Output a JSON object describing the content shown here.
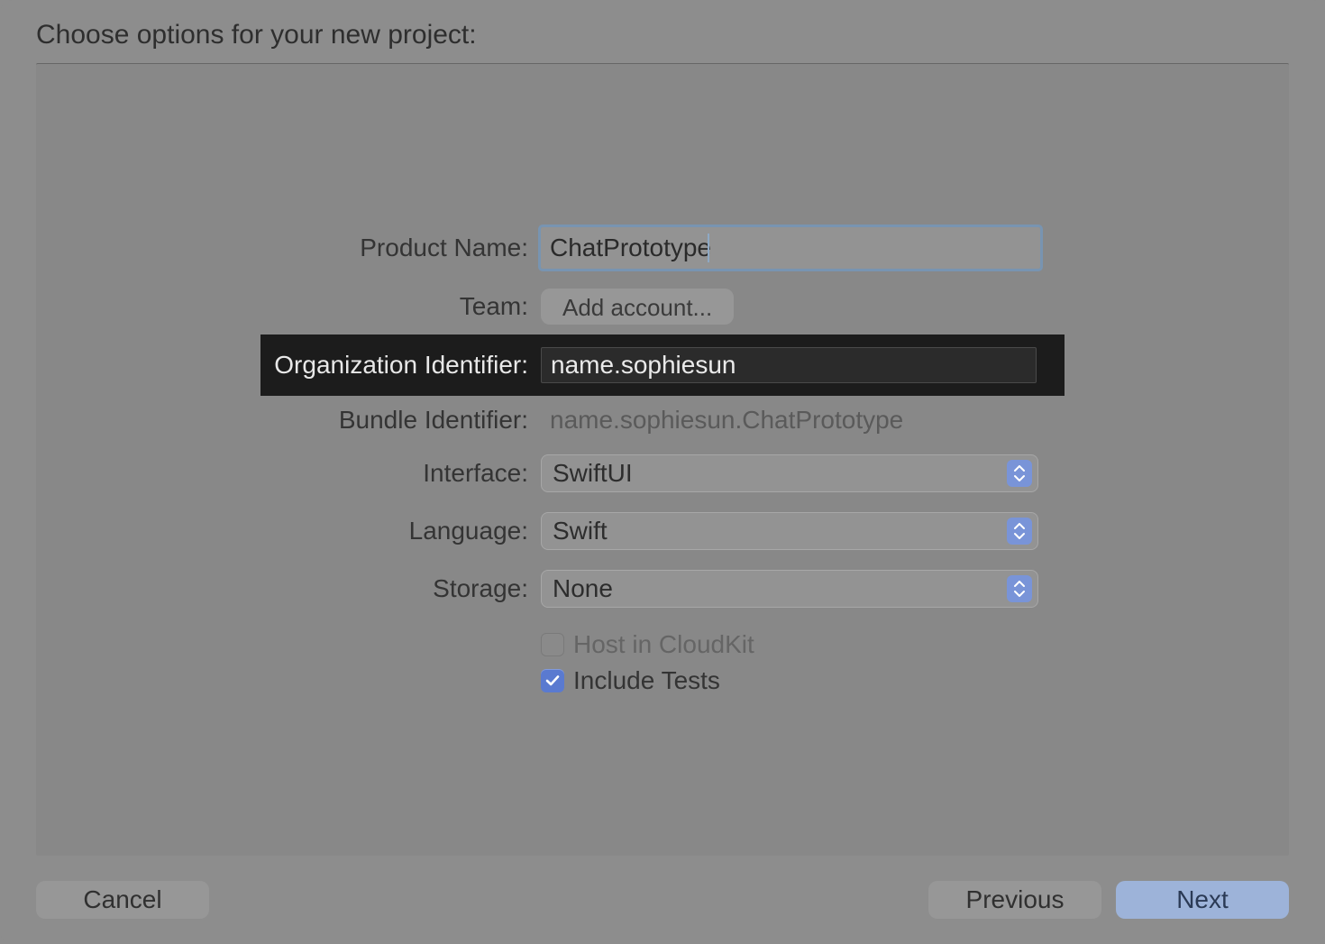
{
  "title": "Choose options for your new project:",
  "labels": {
    "product_name": "Product Name:",
    "team": "Team:",
    "org_id": "Organization Identifier:",
    "bundle_id": "Bundle Identifier:",
    "interface": "Interface:",
    "language": "Language:",
    "storage": "Storage:"
  },
  "fields": {
    "product_name": "ChatPrototype",
    "team_button": "Add account...",
    "org_id": "name.sophiesun",
    "bundle_id": "name.sophiesun.ChatPrototype",
    "interface": "SwiftUI",
    "language": "Swift",
    "storage": "None"
  },
  "checks": {
    "cloudkit_label": "Host in CloudKit",
    "cloudkit_checked": false,
    "cloudkit_enabled": false,
    "tests_label": "Include Tests",
    "tests_checked": true
  },
  "buttons": {
    "cancel": "Cancel",
    "previous": "Previous",
    "next": "Next"
  }
}
